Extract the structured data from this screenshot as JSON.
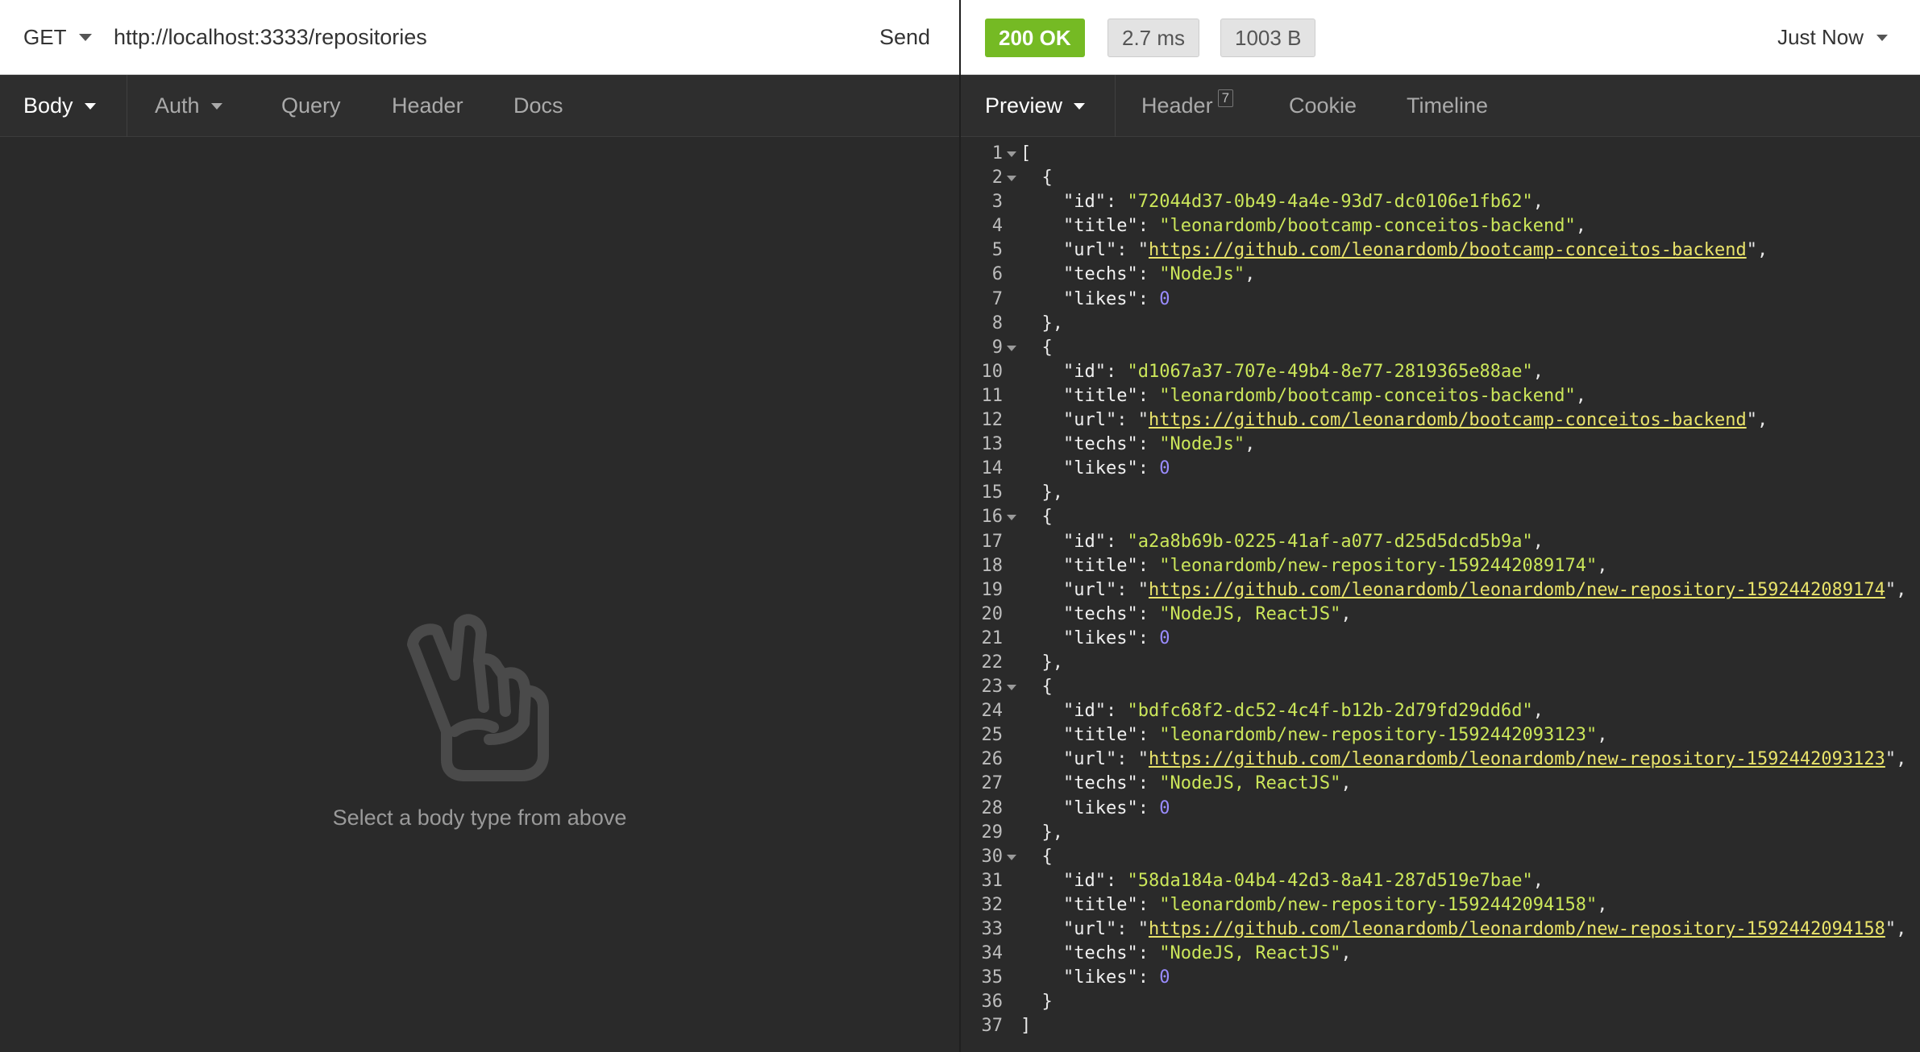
{
  "request": {
    "method": "GET",
    "url": "http://localhost:3333/repositories",
    "send_label": "Send",
    "tabs": [
      {
        "label": "Body",
        "active": true,
        "dropdown": true
      },
      {
        "label": "Auth",
        "active": false,
        "dropdown": true
      },
      {
        "label": "Query",
        "active": false,
        "dropdown": false
      },
      {
        "label": "Header",
        "active": false,
        "dropdown": false
      },
      {
        "label": "Docs",
        "active": false,
        "dropdown": false
      }
    ],
    "empty_message": "Select a body type from above",
    "empty_icon": "peace-hand-icon"
  },
  "response": {
    "status": "200 OK",
    "time": "2.7 ms",
    "size": "1003 B",
    "history_label": "Just Now",
    "tabs": [
      {
        "label": "Preview",
        "active": true,
        "dropdown": true,
        "badge": ""
      },
      {
        "label": "Header",
        "active": false,
        "dropdown": false,
        "badge": "7"
      },
      {
        "label": "Cookie",
        "active": false,
        "dropdown": false,
        "badge": ""
      },
      {
        "label": "Timeline",
        "active": false,
        "dropdown": false,
        "badge": ""
      }
    ],
    "items": [
      {
        "id": "72044d37-0b49-4a4e-93d7-dc0106e1fb62",
        "title": "leonardomb/bootcamp-conceitos-backend",
        "url": "https://github.com/leonardomb/bootcamp-conceitos-backend",
        "techs": "NodeJs",
        "likes": 0
      },
      {
        "id": "d1067a37-707e-49b4-8e77-2819365e88ae",
        "title": "leonardomb/bootcamp-conceitos-backend",
        "url": "https://github.com/leonardomb/bootcamp-conceitos-backend",
        "techs": "NodeJs",
        "likes": 0
      },
      {
        "id": "a2a8b69b-0225-41af-a077-d25d5dcd5b9a",
        "title": "leonardomb/new-repository-1592442089174",
        "url": "https://github.com/leonardomb/leonardomb/new-repository-1592442089174",
        "techs": "NodeJS, ReactJS",
        "likes": 0
      },
      {
        "id": "bdfc68f2-dc52-4c4f-b12b-2d79fd29dd6d",
        "title": "leonardomb/new-repository-1592442093123",
        "url": "https://github.com/leonardomb/leonardomb/new-repository-1592442093123",
        "techs": "NodeJS, ReactJS",
        "likes": 0
      },
      {
        "id": "58da184a-04b4-42d3-8a41-287d519e7bae",
        "title": "leonardomb/new-repository-1592442094158",
        "url": "https://github.com/leonardomb/leonardomb/new-repository-1592442094158",
        "techs": "NodeJS, ReactJS",
        "likes": 0
      }
    ]
  },
  "colors": {
    "status_ok": "#75ba24",
    "json_string": "#cbe65a",
    "json_url": "#e9e36a",
    "json_number": "#9a8cff"
  }
}
